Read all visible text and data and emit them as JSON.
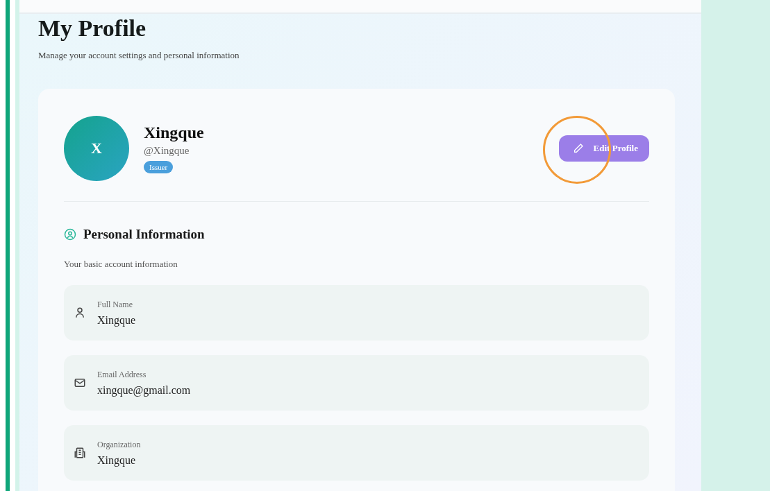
{
  "page": {
    "title": "My Profile",
    "subtitle": "Manage your account settings and personal information"
  },
  "profile": {
    "avatar_initial": "X",
    "name": "Xingque",
    "handle": "@Xingque",
    "role_badge": "Issuer",
    "edit_button": "Edit Profile",
    "edit_button_highlighted": true
  },
  "section": {
    "title": "Personal Information",
    "subtitle": "Your basic account information"
  },
  "fields": [
    {
      "kind": "person",
      "label": "Full Name",
      "value": "Xingque"
    },
    {
      "kind": "email",
      "label": "Email Address",
      "value": "xingque@gmail.com"
    },
    {
      "kind": "organization",
      "label": "Organization",
      "value": "Xingque"
    }
  ]
}
